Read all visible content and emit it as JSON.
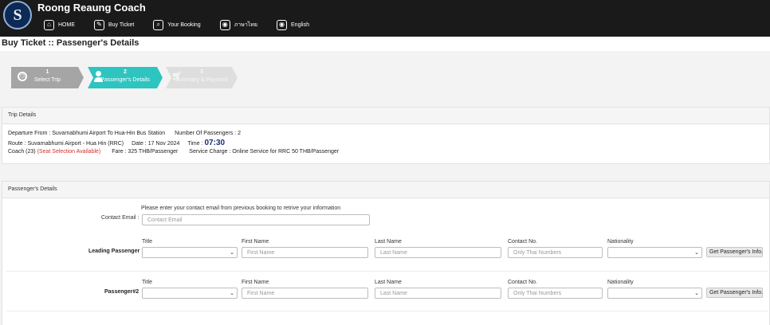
{
  "header": {
    "logo_letter": "S",
    "app_title": "Roong Reaung Coach",
    "nav": [
      {
        "label": "HOME",
        "icon": "home-icon"
      },
      {
        "label": "Buy Ticket",
        "icon": "ticket-icon"
      },
      {
        "label": "Your Booking",
        "icon": "search-icon"
      },
      {
        "label": "ภาษาไทย",
        "icon": "globe-icon"
      },
      {
        "label": "English",
        "icon": "globe-icon"
      }
    ]
  },
  "page_title": "Buy Ticket :: Passenger's Details",
  "steps": [
    {
      "number": "1",
      "label": "Select Trip",
      "state": "completed"
    },
    {
      "number": "2",
      "label": "Passenger's Details",
      "state": "active"
    },
    {
      "number": "3",
      "label": "Summary & Payment",
      "state": "upcoming"
    }
  ],
  "trip_details": {
    "heading": "Trip Details",
    "departure": "Departure From : Suvarnabhumi Airport To Hua-Hin Bus Station",
    "passengers": "Number Of Passengers : 2",
    "route": "Route : Suvarnabhumi Airport - Hua Hin (RRC)",
    "date": "Date : 17 Nov 2024",
    "time_label": "Time :",
    "time_value": "07:30",
    "coach": "Coach (23)",
    "seat_note": "(Seat Selection Available)",
    "fare": "Fare : 325 THB/Passenger",
    "service_charge": "Service Charge : Online Service for RRC 50 THB/Passenger"
  },
  "passenger_details": {
    "heading": "Passenger's Details",
    "contact_hint": "Please enter your contact email from previous booking to retrive your information",
    "contact_label": "Contact Email :",
    "contact_placeholder": "Contact Email",
    "columns": {
      "title": "Title",
      "first_name": "First Name",
      "last_name": "Last Name",
      "contact_no": "Contact No.",
      "nationality": "Nationality"
    },
    "rows": [
      {
        "label": "Leading Passenger",
        "first_placeholder": "First Name",
        "last_placeholder": "Last Name",
        "contact_placeholder": "Only Thai Numbers",
        "button": "Get Passenger's Info."
      },
      {
        "label": "Passenger#2",
        "first_placeholder": "First Name",
        "last_placeholder": "Last Name",
        "contact_placeholder": "Only Thai Numbers",
        "button": "Get Passenger's Info."
      }
    ]
  },
  "colors": {
    "header_bg": "#1a1a1a",
    "active_step": "#2ec4c0",
    "done_step": "#a5a5a5",
    "upcoming_step": "#dedede",
    "seat_note": "#d0312d",
    "time": "#14307a"
  }
}
